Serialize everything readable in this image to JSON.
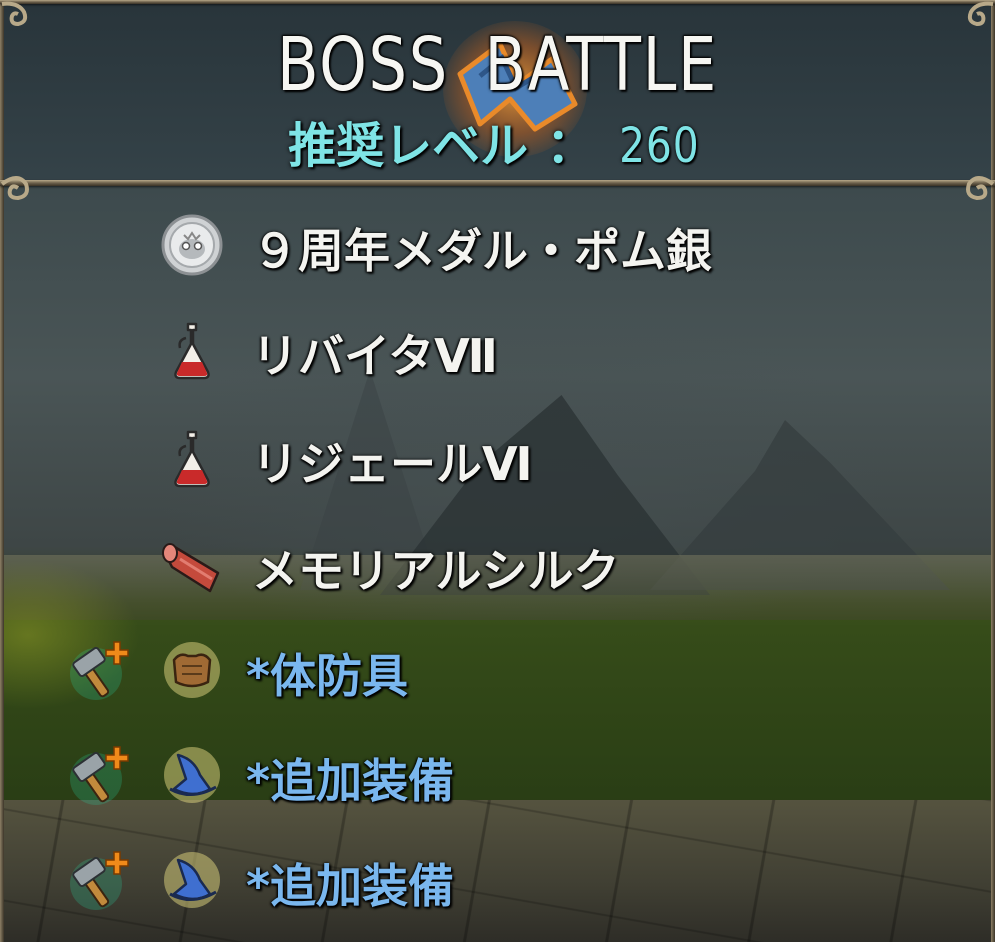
{
  "header": {
    "title": "BOSS BATTLE",
    "level_label": "推奨レベル",
    "level_separator": "：",
    "level_value": "260"
  },
  "rewards": [
    {
      "label": "９周年メダル・ポム銀",
      "icon": "silver-medal-icon",
      "upgrade": false
    },
    {
      "label": "リバイタⅦ",
      "icon": "potion-flask-icon",
      "upgrade": false
    },
    {
      "label": "リジェールⅥ",
      "icon": "potion-flask-icon",
      "upgrade": false
    },
    {
      "label": "メモリアルシルク",
      "icon": "silk-scroll-icon",
      "upgrade": false
    },
    {
      "label": "*体防具",
      "icon": "body-armor-icon",
      "upgrade": true
    },
    {
      "label": "*追加装備",
      "icon": "wizard-hat-icon",
      "upgrade": true
    },
    {
      "label": "*追加装備",
      "icon": "wizard-hat-icon",
      "upgrade": true
    }
  ],
  "colors": {
    "title": "#f6f6f2",
    "level": "#7fe4e6",
    "item_text": "#f4f4f0",
    "equipment_text": "#7ab7ee",
    "frame": "#b8a989"
  }
}
